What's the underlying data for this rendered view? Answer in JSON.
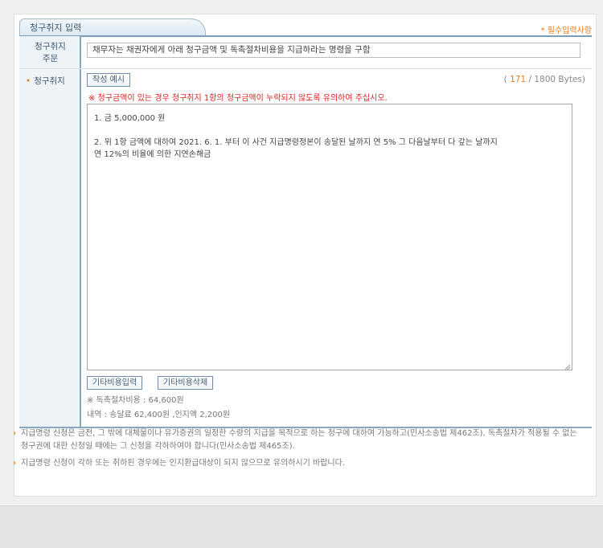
{
  "tab": {
    "title": "청구취지 입력",
    "required_note": "* 필수입력사항"
  },
  "order_row": {
    "label_line1": "청구취지",
    "label_line2": "주문",
    "value": "채무자는 채권자에게 아래 청구금액 및 독촉절차비용을 지급하라는 명령을 구함"
  },
  "claim_row": {
    "label_mark": "•",
    "label": "청구취지",
    "example_button": "작성 예시",
    "bytes_open": "(",
    "bytes_count": "171",
    "bytes_rest": "/ 1800 Bytes)",
    "warning": "※ 청구금액이 있는 경우 청구취지 1항의 청구금액이 누락되지 않도록 유의하여 주십시오.",
    "content": {
      "line1": "1. 금 5,000,000 원",
      "line2": "2. 위 1항 금액에 대하여 2021. 6. 1. 부터 이 사건 지급명령정본이 송달된 날까지 연 5% 그 다음날부터 다 갚는 날까지",
      "line3": "연 12%의 비율에 의한 지연손해금"
    },
    "add_cost_button": "기타비용입력",
    "delete_cost_button": "기타비용삭제",
    "cost_total": "※ 독촉절차비용 : 64,600원",
    "cost_detail": "내역 : 송달료 62,400원 ,인지액 2,200원"
  },
  "notes": [
    "지급명령 신청은 금전, 그 밖에 대체물이나 유가증권의 일정한 수량의 지급을 목적으로 하는 청구에 대하여 가능하고(민사소송법 제462조), 독촉절차가 적용될 수 없는 청구권에 대한 신청일 때에는 그 신청을 각하하여야 합니다(민사소송법 제465조).",
    "지급명령 신청이 각하 또는 취하된 경우에는 인지환급대상이 되지 않으므로 유의하시기 바랍니다."
  ],
  "colors": {
    "accent": "#f07a1a",
    "warning": "#e02020",
    "border": "#8ba7be",
    "label_bg": "#eef3f8"
  },
  "icons": {
    "note_arrow": "chevron-right-icon",
    "resize": "resize-grip-icon"
  }
}
